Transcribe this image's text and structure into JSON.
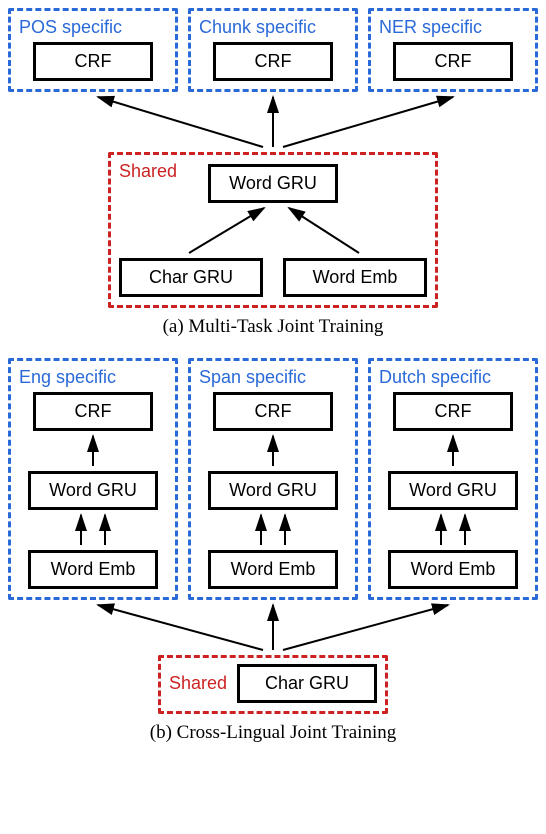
{
  "fig_a": {
    "caption": "(a)  Multi-Task Joint Training",
    "top_groups": [
      {
        "label": "POS specific",
        "block": "CRF"
      },
      {
        "label": "Chunk specific",
        "block": "CRF"
      },
      {
        "label": "NER specific",
        "block": "CRF"
      }
    ],
    "shared_label": "Shared",
    "shared_top": "Word GRU",
    "shared_left": "Char GRU",
    "shared_right": "Word Emb"
  },
  "fig_b": {
    "caption": "(b)  Cross-Lingual Joint Training",
    "columns": [
      {
        "label": "Eng specific",
        "crf": "CRF",
        "wgru": "Word GRU",
        "wemb": "Word Emb"
      },
      {
        "label": "Span specific",
        "crf": "CRF",
        "wgru": "Word GRU",
        "wemb": "Word Emb"
      },
      {
        "label": "Dutch specific",
        "crf": "CRF",
        "wgru": "Word GRU",
        "wemb": "Word Emb"
      }
    ],
    "shared_label": "Shared",
    "shared_block": "Char GRU"
  }
}
